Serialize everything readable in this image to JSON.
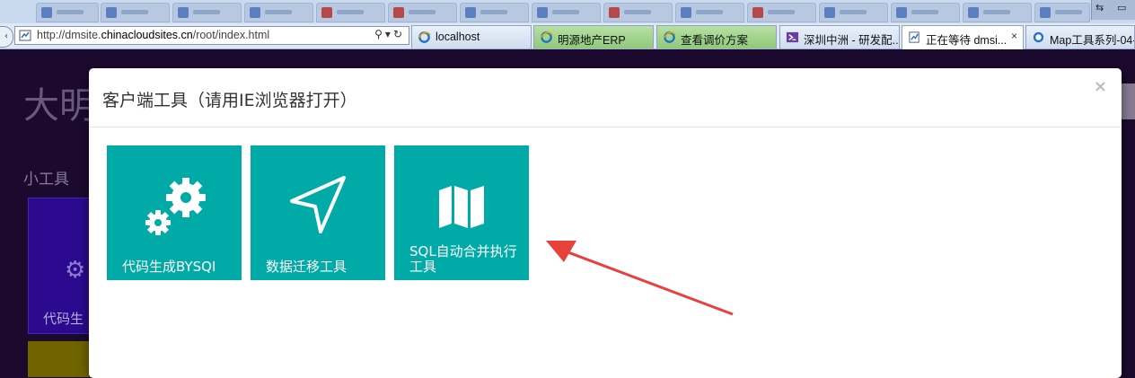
{
  "browser": {
    "address_url_prefix": "http://dmsite.",
    "address_url_domain": "chinacloudsites.cn",
    "address_url_path": "/root/index.html",
    "tabs": [
      {
        "label": "localhost",
        "icon": "ie-icon",
        "style": "normal"
      },
      {
        "label": "明源地产ERP",
        "icon": "ie-icon",
        "style": "green"
      },
      {
        "label": "查看调价方案",
        "icon": "ie-icon",
        "style": "green"
      },
      {
        "label": "深圳中洲 - 研发配...",
        "icon": "vs-icon",
        "style": "normal"
      },
      {
        "label": "正在等待 dmsi...",
        "icon": "loading-page-icon",
        "style": "active",
        "close": "×"
      },
      {
        "label": "Map工具系列-04-",
        "icon": "ie-icon",
        "style": "normal"
      }
    ]
  },
  "background_page": {
    "title": "大明",
    "section_label": "小工具",
    "card_label": "代码生"
  },
  "modal": {
    "title": "客户端工具（请用IE浏览器打开）",
    "close": "×",
    "tiles": [
      {
        "label": "代码生成BYSQI",
        "icon": "gears-icon"
      },
      {
        "label": "数据迁移工具",
        "icon": "navigation-arrow-icon"
      },
      {
        "label": "SQL自动合并执行工具",
        "icon": "map-icon"
      }
    ]
  },
  "colors": {
    "tile": "#00aaa7",
    "annotation_arrow": "#e8413c"
  }
}
